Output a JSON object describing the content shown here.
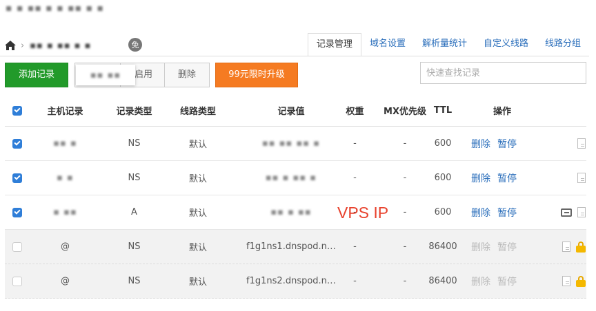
{
  "header": {
    "top_blurred": "▪ ▪ ▪▪ ▪ ▪ ▪▪ ▪ ▪",
    "domain_blurred": "▪▪ ▪ ▪▪ ▪ ▪",
    "free_badge": "免"
  },
  "tabs": [
    {
      "label": "记录管理",
      "active": true
    },
    {
      "label": "域名设置"
    },
    {
      "label": "解析量统计"
    },
    {
      "label": "自定义线路"
    },
    {
      "label": "线路分组"
    }
  ],
  "toolbar": {
    "add_label": "添加记录",
    "blurred_label": "▪▪ ▪▪",
    "enable_label": "启用",
    "delete_label": "删除",
    "upgrade_label": "99元限时升级",
    "search_placeholder": "快速查找记录"
  },
  "columns": [
    "主机记录",
    "记录类型",
    "线路类型",
    "记录值",
    "权重",
    "MX优先级",
    "TTL",
    "操作"
  ],
  "rows": [
    {
      "host": "▪▪ ▪",
      "type": "NS",
      "line": "默认",
      "value": "▪▪ ▪▪ ▪▪ ▪",
      "weight": "-",
      "mx": "-",
      "ttl": "600",
      "op_delete": "删除",
      "op_pause": "暂停"
    },
    {
      "host": "▪ ▪",
      "type": "NS",
      "line": "默认",
      "value": "▪▪ ▪ ▪▪ ▪",
      "weight": "-",
      "mx": "-",
      "ttl": "600",
      "op_delete": "删除",
      "op_pause": "暂停"
    },
    {
      "host": "▪ ▪▪",
      "type": "A",
      "line": "默认",
      "value": "▪▪ ▪ ▪▪",
      "weight": "-",
      "mx": "-",
      "ttl": "600",
      "op_delete": "删除",
      "op_pause": "暂停"
    },
    {
      "host": "@",
      "type": "NS",
      "line": "默认",
      "value": "f1g1ns1.dnspod.n…",
      "weight": "-",
      "mx": "-",
      "ttl": "86400",
      "op_delete": "删除",
      "op_pause": "暂停"
    },
    {
      "host": "@",
      "type": "NS",
      "line": "默认",
      "value": "f1g1ns2.dnspod.n…",
      "weight": "-",
      "mx": "-",
      "ttl": "86400",
      "op_delete": "删除",
      "op_pause": "暂停"
    }
  ],
  "annotation": "VPS IP",
  "colors": {
    "accent_green": "#229a2a",
    "accent_orange": "#f57b22",
    "link_blue": "#2a6ebb",
    "annotation_red": "#e8412c"
  }
}
